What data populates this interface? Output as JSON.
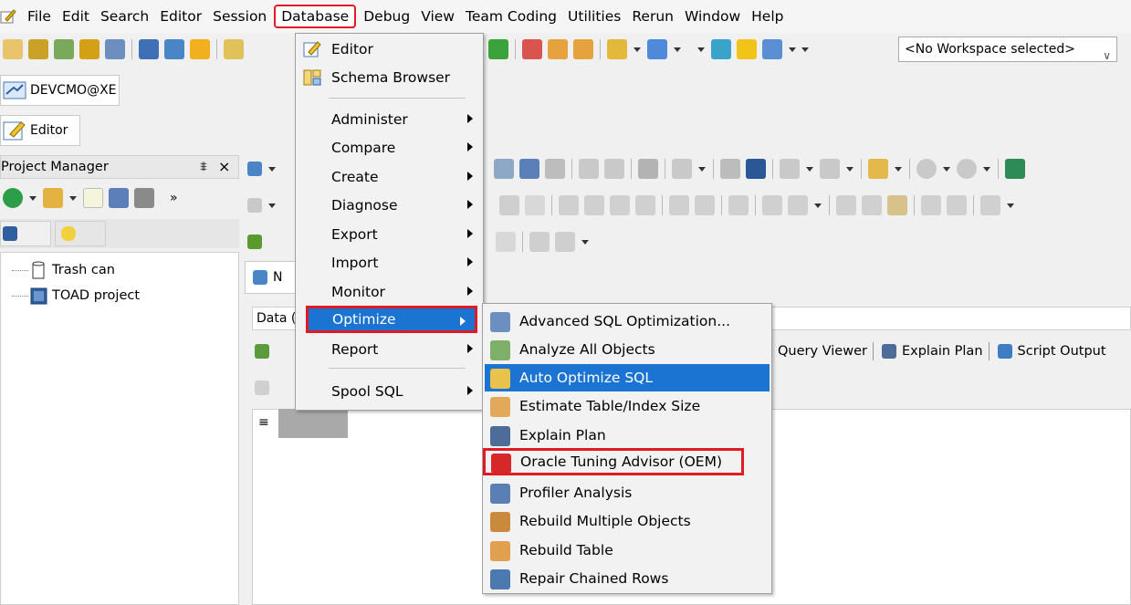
{
  "menubar": {
    "items": [
      "File",
      "Edit",
      "Search",
      "Editor",
      "Session",
      "Database",
      "Debug",
      "View",
      "Team Coding",
      "Utilities",
      "Rerun",
      "Window",
      "Help"
    ],
    "open_item": "Database"
  },
  "toolbar": {
    "workspace_select": "<No Workspace selected>"
  },
  "connection": {
    "label": "DEVCMO@XE"
  },
  "editor_tab": {
    "label": "Editor"
  },
  "project_manager": {
    "title": "Project Manager",
    "pin_glyph": "1",
    "close_glyph": "×",
    "tree": [
      {
        "label": "Trash can",
        "icon": "trash-can-icon"
      },
      {
        "label": "TOAD project",
        "icon": "project-icon"
      }
    ]
  },
  "editor": {
    "doc_tab_label": "N",
    "result_bar_label": "Data (",
    "result_tabs": [
      "Query Viewer",
      "Explain Plan",
      "Script Output"
    ]
  },
  "database_menu": {
    "items": [
      {
        "label": "Editor",
        "icon": "editor-icon",
        "submenu": false
      },
      {
        "label": "Schema Browser",
        "icon": "schema-browser-icon",
        "submenu": false
      },
      {
        "label": "Administer",
        "submenu": true
      },
      {
        "label": "Compare",
        "submenu": true
      },
      {
        "label": "Create",
        "submenu": true
      },
      {
        "label": "Diagnose",
        "submenu": true
      },
      {
        "label": "Export",
        "submenu": true
      },
      {
        "label": "Import",
        "submenu": true
      },
      {
        "label": "Monitor",
        "submenu": true
      },
      {
        "label": "Optimize",
        "submenu": true,
        "highlighted": true
      },
      {
        "label": "Report",
        "submenu": true
      },
      {
        "label": "Spool SQL",
        "submenu": true
      }
    ]
  },
  "optimize_menu": {
    "items": [
      {
        "label": "Advanced SQL Optimization...",
        "icon": "advanced-sql-icon"
      },
      {
        "label": "Analyze All Objects",
        "icon": "analyze-icon"
      },
      {
        "label": "Auto Optimize SQL",
        "icon": "auto-optimize-icon",
        "highlighted": true
      },
      {
        "label": "Estimate Table/Index Size",
        "icon": "estimate-size-icon"
      },
      {
        "label": "Explain Plan",
        "icon": "explain-plan-icon"
      },
      {
        "label": "Oracle Tuning Advisor (OEM)",
        "icon": "oracle-tuning-icon",
        "boxed": true
      },
      {
        "label": "Profiler Analysis",
        "icon": "profiler-icon"
      },
      {
        "label": "Rebuild Multiple Objects",
        "icon": "rebuild-multiple-icon"
      },
      {
        "label": "Rebuild Table",
        "icon": "rebuild-table-icon"
      },
      {
        "label": "Repair Chained Rows",
        "icon": "repair-rows-icon"
      }
    ]
  },
  "colors": {
    "highlight": "#1c74d2",
    "annotation_red": "#e01b24"
  }
}
